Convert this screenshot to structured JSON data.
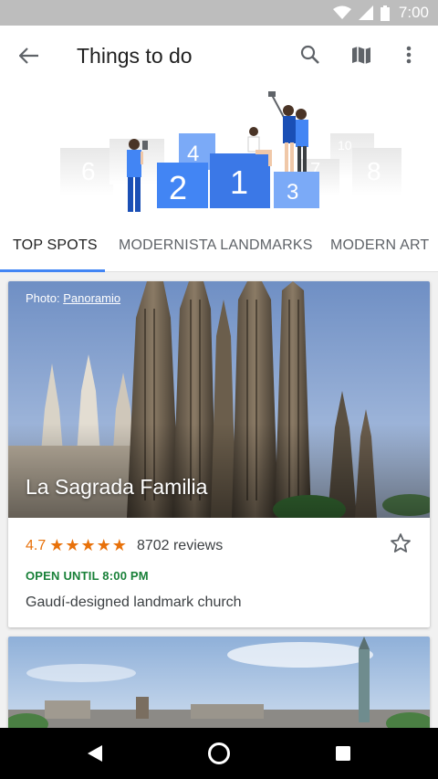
{
  "status_bar": {
    "time": "7:00"
  },
  "app_bar": {
    "title": "Things to do"
  },
  "hero": {
    "blocks": [
      "6",
      "4",
      "2",
      "1",
      "3",
      "7",
      "10",
      "8"
    ]
  },
  "tabs": [
    {
      "label": "TOP SPOTS",
      "active": true
    },
    {
      "label": "MODERNISTA LANDMARKS",
      "active": false
    },
    {
      "label": "MODERN ART",
      "active": false
    }
  ],
  "cards": [
    {
      "photo_credit_prefix": "Photo: ",
      "photo_credit_link": "Panoramio",
      "name": "La Sagrada Familia",
      "rating": "4.7",
      "stars": "★★★★★",
      "reviews": "8702 reviews",
      "status": "OPEN UNTIL 8:00 PM",
      "description": "Gaudí-designed landmark church"
    }
  ],
  "colors": {
    "accent_blue": "#4285f4",
    "rating_orange": "#e8710a",
    "open_green": "#188038"
  }
}
